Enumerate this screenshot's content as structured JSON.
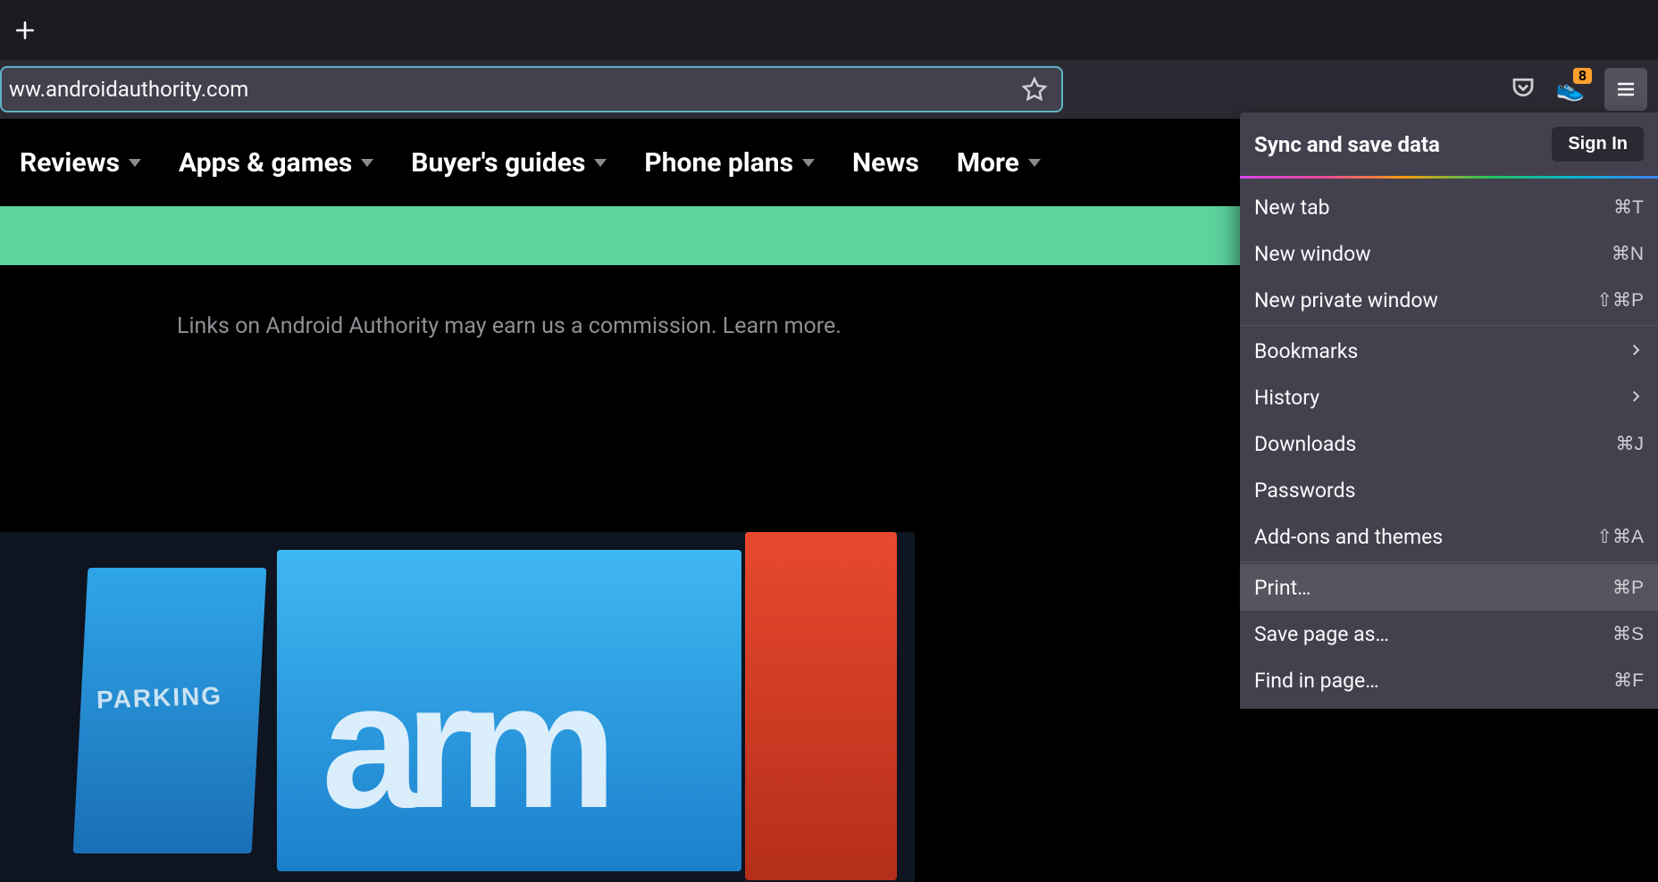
{
  "toolbar": {
    "url": "ww.androidauthority.com",
    "extension_badge": "8"
  },
  "nav": {
    "items": [
      {
        "label": "Reviews",
        "caret": true
      },
      {
        "label": "Apps & games",
        "caret": true
      },
      {
        "label": "Buyer's guides",
        "caret": true
      },
      {
        "label": "Phone plans",
        "caret": true
      },
      {
        "label": "News",
        "caret": false
      },
      {
        "label": "More",
        "caret": true
      }
    ]
  },
  "page": {
    "disclosure": "Links on Android Authority may earn us a commission. ",
    "learn_more": "Learn more.",
    "hero_text_small": "PARKING",
    "hero_text_big": "arm"
  },
  "menu": {
    "header_title": "Sync and save data",
    "signin_label": "Sign In",
    "items": [
      {
        "label": "New tab",
        "shortcut": "⌘T",
        "type": "item"
      },
      {
        "label": "New window",
        "shortcut": "⌘N",
        "type": "item"
      },
      {
        "label": "New private window",
        "shortcut": "⇧⌘P",
        "type": "item"
      },
      {
        "type": "sep"
      },
      {
        "label": "Bookmarks",
        "submenu": true,
        "type": "item"
      },
      {
        "label": "History",
        "submenu": true,
        "type": "item"
      },
      {
        "label": "Downloads",
        "shortcut": "⌘J",
        "type": "item"
      },
      {
        "label": "Passwords",
        "type": "item"
      },
      {
        "label": "Add-ons and themes",
        "shortcut": "⇧⌘A",
        "type": "item"
      },
      {
        "type": "sep"
      },
      {
        "label": "Print…",
        "shortcut": "⌘P",
        "type": "item",
        "hover": true
      },
      {
        "label": "Save page as…",
        "shortcut": "⌘S",
        "type": "item"
      },
      {
        "label": "Find in page…",
        "shortcut": "⌘F",
        "type": "item"
      }
    ]
  }
}
